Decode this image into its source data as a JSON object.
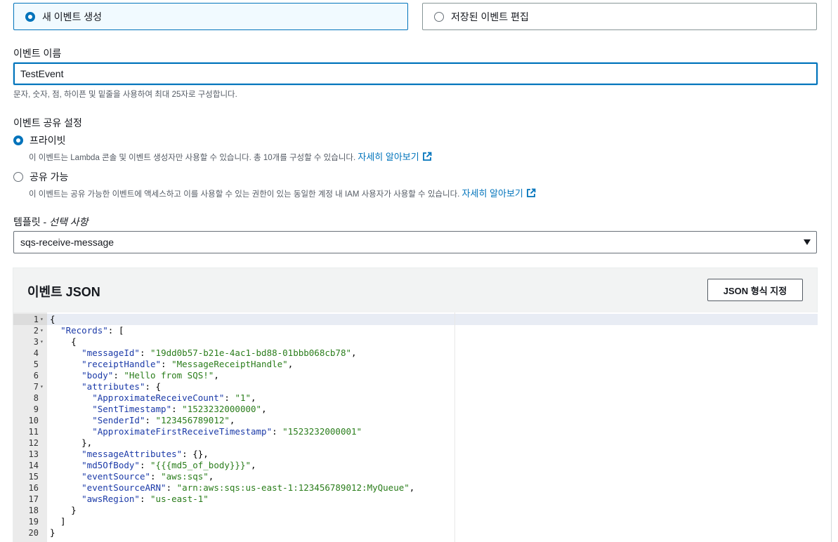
{
  "tiles": {
    "new_event": "새 이벤트 생성",
    "edit_saved": "저장된 이벤트 편집"
  },
  "event_name": {
    "label": "이벤트 이름",
    "value": "TestEvent",
    "hint": "문자, 숫자, 점, 하이픈 및 밑줄을 사용하여 최대 25자로 구성합니다."
  },
  "sharing": {
    "label": "이벤트 공유 설정",
    "private_label": "프라이빗",
    "private_desc": "이 이벤트는 Lambda 콘솔 및 이벤트 생성자만 사용할 수 있습니다. 총 10개를 구성할 수 있습니다.",
    "shareable_label": "공유 가능",
    "shareable_desc": "이 이벤트는 공유 가능한 이벤트에 액세스하고 이를 사용할 수 있는 권한이 있는 동일한 계정 내 IAM 사용자가 사용할 수 있습니다.",
    "learn_more": "자세히 알아보기"
  },
  "template": {
    "label_main": "템플릿 - ",
    "label_optional": "선택 사항",
    "selected": "sqs-receive-message"
  },
  "json_panel": {
    "title": "이벤트 JSON",
    "format_button": "JSON 형식 지정"
  },
  "code_lines": [
    "{",
    "  \"Records\": [",
    "    {",
    "      \"messageId\": \"19dd0b57-b21e-4ac1-bd88-01bbb068cb78\",",
    "      \"receiptHandle\": \"MessageReceiptHandle\",",
    "      \"body\": \"Hello from SQS!\",",
    "      \"attributes\": {",
    "        \"ApproximateReceiveCount\": \"1\",",
    "        \"SentTimestamp\": \"1523232000000\",",
    "        \"SenderId\": \"123456789012\",",
    "        \"ApproximateFirstReceiveTimestamp\": \"1523232000001\"",
    "      },",
    "      \"messageAttributes\": {},",
    "      \"md5OfBody\": \"{{{md5_of_body}}}\",",
    "      \"eventSource\": \"aws:sqs\",",
    "      \"eventSourceARN\": \"arn:aws:sqs:us-east-1:123456789012:MyQueue\",",
    "      \"awsRegion\": \"us-east-1\"",
    "    }",
    "  ]",
    "}"
  ],
  "fold_lines": [
    1,
    2,
    3,
    7
  ],
  "colors": {
    "accent": "#0073bb",
    "json_key": "#1b3aa8",
    "json_string": "#2a7d1b"
  }
}
